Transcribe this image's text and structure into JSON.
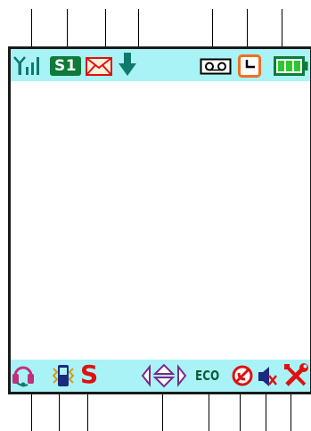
{
  "status_bar_top": {
    "sim_badge": "S1",
    "icons": [
      "signal-strength-icon",
      "sim-badge",
      "message-envelope-icon",
      "download-arrow-icon",
      "voicemail-icon",
      "alarm-clock-icon",
      "battery-icon"
    ]
  },
  "status_bar_bottom": {
    "silent_letter": "S",
    "eco_label": "ECO",
    "icons": [
      "headset-icon",
      "vibrate-phone-icon",
      "silent-mode-icon",
      "navigation-keys-icon",
      "eco-mode-icon",
      "no-call-icon",
      "speaker-muted-icon",
      "settings-tools-icon"
    ]
  },
  "colors": {
    "status_bar_bg": "#a9f3f6",
    "icon_teal": "#0f7a6a",
    "sim_green": "#0f7a3a",
    "alert_red": "#e01010",
    "alarm_orange": "#f07020"
  }
}
